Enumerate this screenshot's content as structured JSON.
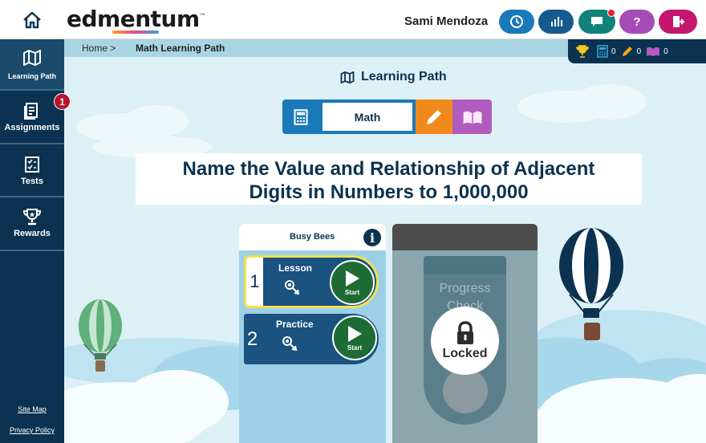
{
  "header": {
    "logo_text": "edmentum",
    "logo_tm": "™",
    "user_name": "Sami Mendoza",
    "help_label": "?",
    "icons": [
      "home-icon",
      "clock-icon",
      "bar-chart-icon",
      "message-icon",
      "help-icon",
      "exit-icon"
    ],
    "colors": {
      "clock": "#1a79b9",
      "stats": "#145a8d",
      "message": "#11827a",
      "help": "#a44bb5",
      "exit": "#c3166e"
    }
  },
  "sidebar": {
    "items": [
      {
        "label": "Learning Path",
        "icon": "map-icon",
        "active": true
      },
      {
        "label": "Assignments",
        "icon": "assignments-icon",
        "badge": "1"
      },
      {
        "label": "Tests",
        "icon": "checklist-icon"
      },
      {
        "label": "Rewards",
        "icon": "trophy-icon"
      }
    ],
    "site_map": "Site Map",
    "privacy_policy": "Privacy Policy"
  },
  "breadcrumb": {
    "home": "Home >",
    "current": "Math Learning Path"
  },
  "rewards_bar": {
    "items": [
      {
        "icon": "trophy-icon",
        "count": ""
      },
      {
        "icon": "calculator-icon",
        "count": "0"
      },
      {
        "icon": "pencil-icon",
        "count": "0"
      },
      {
        "icon": "book-icon",
        "count": "0"
      }
    ]
  },
  "main": {
    "page_title": "Learning Path",
    "subjects": {
      "active": "Math",
      "items": [
        "calculator-icon",
        "Math",
        "pencil-icon",
        "book-icon"
      ]
    },
    "lesson_title_line1": "Name the Value and Relationship of Adjacent",
    "lesson_title_line2": "Digits in Numbers to 1,000,000",
    "module": {
      "title": "Busy Bees",
      "activities": [
        {
          "number": "1",
          "name": "Lesson",
          "action": "Start"
        },
        {
          "number": "2",
          "name": "Practice",
          "action": "Start"
        }
      ]
    },
    "progress_check": {
      "line1": "Progress",
      "line2": "Check",
      "status": "Locked"
    }
  }
}
